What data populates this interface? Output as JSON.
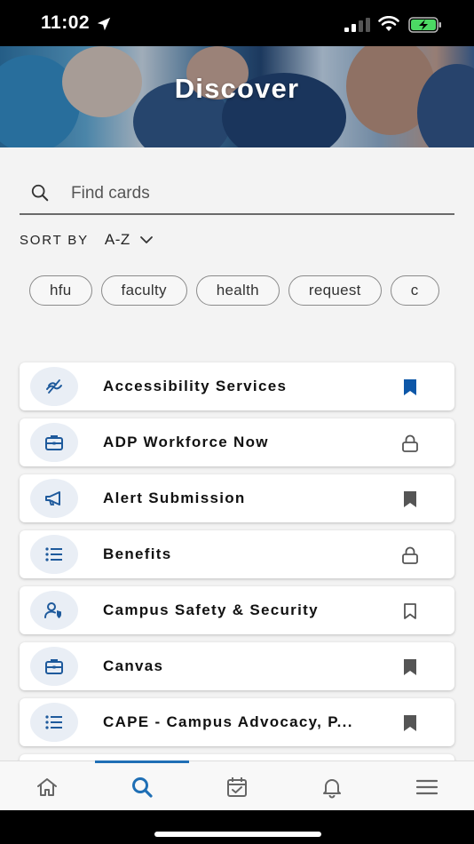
{
  "status": {
    "time": "11:02"
  },
  "hero": {
    "title": "Discover"
  },
  "search": {
    "placeholder": "Find cards"
  },
  "sort": {
    "label": "SORT BY",
    "value": "A-Z"
  },
  "chips": [
    "hfu",
    "faculty",
    "health",
    "request",
    "c"
  ],
  "cards": [
    {
      "label": "Accessibility Services",
      "icon": "accessibility-icon",
      "action": "bookmark-filled-blue"
    },
    {
      "label": "ADP Workforce Now",
      "icon": "briefcase-icon",
      "action": "lock"
    },
    {
      "label": "Alert Submission",
      "icon": "megaphone-icon",
      "action": "bookmark-filled"
    },
    {
      "label": "Benefits",
      "icon": "list-icon",
      "action": "lock"
    },
    {
      "label": "Campus Safety & Security",
      "icon": "user-shield-icon",
      "action": "bookmark-outline"
    },
    {
      "label": "Canvas",
      "icon": "briefcase-icon",
      "action": "bookmark-filled"
    },
    {
      "label": "CAPE - Campus Advocacy, P...",
      "icon": "list-icon",
      "action": "bookmark-filled"
    }
  ],
  "tabs": [
    {
      "name": "home",
      "icon": "home-icon",
      "active": false
    },
    {
      "name": "discover",
      "icon": "search-icon",
      "active": true
    },
    {
      "name": "tasks",
      "icon": "calendar-check-icon",
      "active": false
    },
    {
      "name": "notifications",
      "icon": "bell-icon",
      "active": false
    },
    {
      "name": "menu",
      "icon": "hamburger-menu-icon",
      "active": false
    }
  ],
  "colors": {
    "accent": "#1f6fb5",
    "icon_blue": "#1e5a9c",
    "action_gray": "#555555",
    "bookmark_blue": "#0d57a8"
  }
}
